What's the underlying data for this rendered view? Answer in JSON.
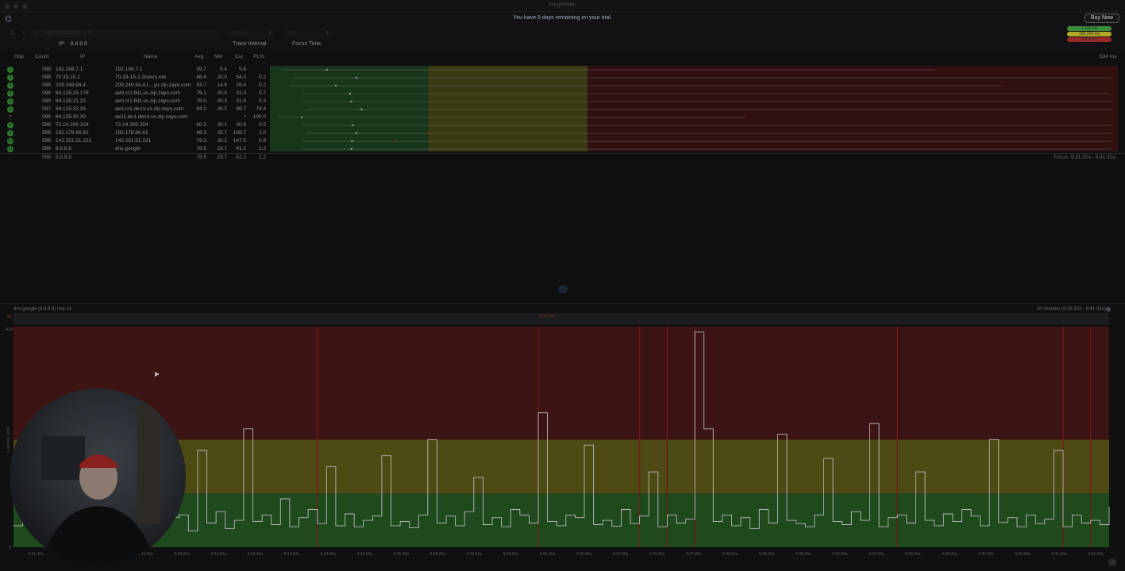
{
  "window": {
    "title": "PingPlotter"
  },
  "banner": {
    "trial_text": "You have 5 days remaining on your trial.",
    "buy_label": "Buy Now"
  },
  "toolbar": {
    "search_placeholder": "Enter target name or IP",
    "interval_value": "Interval",
    "focus_value": "Auto",
    "ip_label": "IP:",
    "ip_value": "8.8.8.8",
    "trace_interval_label": "Trace Interval",
    "focus_time_label": "Focus Time"
  },
  "legend": {
    "items": [
      {
        "label": "0-100 ms",
        "color": "#3b8f3a"
      },
      {
        "label": "100-200 ms",
        "color": "#b3a829"
      },
      {
        "label": "200+ ms",
        "color": "#9a2a2a"
      }
    ]
  },
  "table": {
    "headers": {
      "hop": "Hop",
      "count": "Count",
      "ip": "IP",
      "name": "Name",
      "avg": "Avg",
      "min": "Min",
      "cur": "Cur",
      "pl": "PL%"
    },
    "max_label": "534 ms",
    "rows": [
      {
        "hop": "1",
        "count": "598",
        "ip": "192.168.7.1",
        "name": "192.168.7.1",
        "avg": "39.7",
        "min": "5.4",
        "cur": "5.8",
        "pl": ""
      },
      {
        "hop": "2",
        "count": "598",
        "ip": "70.33.15.2",
        "name": "70-33-15-2.3rivers.net",
        "avg": "86.4",
        "min": "20.0",
        "cur": "54.3",
        "pl": "0.2"
      },
      {
        "hop": "3",
        "count": "598",
        "ip": "209.249.94.4",
        "name": "209.249.94.4.I....yo.zip.zayo.com",
        "avg": "53.7",
        "min": "14.6",
        "cur": "26.4",
        "pl": "0.2"
      },
      {
        "hop": "4",
        "count": "598",
        "ip": "64.125.26.176",
        "name": "ae9.cr2.bil1.us.zip.zayo.com",
        "avg": "76.1",
        "min": "30.4",
        "cur": "31.3",
        "pl": "0.7"
      },
      {
        "hop": "5",
        "count": "598",
        "ip": "64.125.21.22",
        "name": "ae0.cr1.bil1.us.zip.zayo.com",
        "avg": "78.0",
        "min": "30.3",
        "cur": "31.8",
        "pl": "0.3"
      },
      {
        "hop": "6",
        "count": "597",
        "ip": "64.125.22.26",
        "name": "ae3.cr1.den3.us.zip.zayo.com",
        "avg": "94.2",
        "min": "36.5",
        "cur": "89.7",
        "pl": "74.4"
      },
      {
        "hop": "7",
        "count": "596",
        "ip": "64.125.30.39",
        "name": "ae11.ter1.den3.us.zip.zayo.com",
        "avg": "",
        "min": "",
        "cur": "*",
        "pl": "100.0"
      },
      {
        "hop": "8",
        "count": "598",
        "ip": "72.14.209.254",
        "name": "72.14.209.254",
        "avg": "80.3",
        "min": "30.1",
        "cur": "30.9",
        "pl": "0.5"
      },
      {
        "hop": "9",
        "count": "598",
        "ip": "192.178.86.61",
        "name": "192.178.86.61",
        "avg": "86.3",
        "min": "35.7",
        "cur": "198.7",
        "pl": "1.0"
      },
      {
        "hop": "10",
        "count": "598",
        "ip": "142.251.51.221",
        "name": "142.251.51.221",
        "avg": "79.3",
        "min": "30.2",
        "cur": "147.5",
        "pl": "0.8"
      },
      {
        "hop": "11",
        "count": "598",
        "ip": "8.8.8.8",
        "name": "dns.google",
        "avg": "78.5",
        "min": "29.7",
        "cur": "41.2",
        "pl": "1.2"
      }
    ],
    "summary": {
      "count": "598",
      "ip": "8.8.8.8",
      "avg": "78.5",
      "min": "29.7",
      "cur": "41.2",
      "pl": "1.2"
    },
    "focus_text": "Focus: 9:31:32a - 9:41:32a"
  },
  "chart": {
    "title": "dns.google (8.8.8.8) hop 11",
    "range_label": "10 minutes (9:31:32a - 9:41:32a)",
    "y_label": "Latency (ms)",
    "y_max_label": "410",
    "y_zero_label": "0",
    "overview_label": "30",
    "overview_center_label": "9:36:32a"
  },
  "chart_data": {
    "type": "line",
    "title": "dns.google (8.8.8.8) hop 11",
    "ylabel": "Latency (ms)",
    "xlabel": "",
    "ylim": [
      0,
      410
    ],
    "x_ticks": [
      "9:31:40a",
      "9:32:00a",
      "9:32:20a",
      "9:32:40a",
      "9:33:00a",
      "9:33:20a",
      "9:33:40a",
      "9:34:00a",
      "9:34:20a",
      "9:34:40a",
      "9:35:00a",
      "9:35:20a",
      "9:35:40a",
      "9:36:00a",
      "9:36:20a",
      "9:36:40a",
      "9:37:00a",
      "9:37:20a",
      "9:37:40a",
      "9:38:00a",
      "9:38:20a",
      "9:38:40a",
      "9:39:00a",
      "9:39:20a",
      "9:39:40a",
      "9:40:00a",
      "9:40:20a",
      "9:40:40a",
      "9:41:00a",
      "9:41:20a"
    ],
    "bands": [
      {
        "from": 0,
        "to": 100,
        "color": "#1f4a1e"
      },
      {
        "from": 100,
        "to": 200,
        "color": "#4d4a14"
      },
      {
        "from": 200,
        "to": 410,
        "color": "#3d1414"
      }
    ],
    "series": [
      {
        "values": [
          40,
          48,
          60,
          35,
          110,
          42,
          38,
          55,
          70,
          33,
          60,
          45,
          120,
          50,
          38,
          240,
          42,
          55,
          60,
          30,
          180,
          45,
          66,
          35,
          50,
          220,
          48,
          60,
          42,
          90,
          38,
          55,
          70,
          44,
          150,
          40,
          62,
          38,
          50,
          58,
          170,
          40,
          48,
          36,
          60,
          200,
          45,
          58,
          40,
          66,
          130,
          42,
          55,
          38,
          70,
          60,
          45,
          250,
          48,
          40,
          60,
          55,
          190,
          42,
          50,
          39,
          70,
          44,
          58,
          140,
          38,
          60,
          45,
          52,
          400,
          220,
          48,
          60,
          40,
          55,
          35,
          70,
          45,
          210,
          50,
          44,
          38,
          60,
          165,
          48,
          42,
          66,
          50,
          230,
          38,
          55,
          60,
          45,
          140,
          50,
          40,
          62,
          48,
          70,
          58,
          40,
          200,
          46,
          55,
          38,
          60,
          44,
          52,
          180,
          38,
          60,
          45,
          50,
          42,
          75
        ]
      }
    ]
  }
}
